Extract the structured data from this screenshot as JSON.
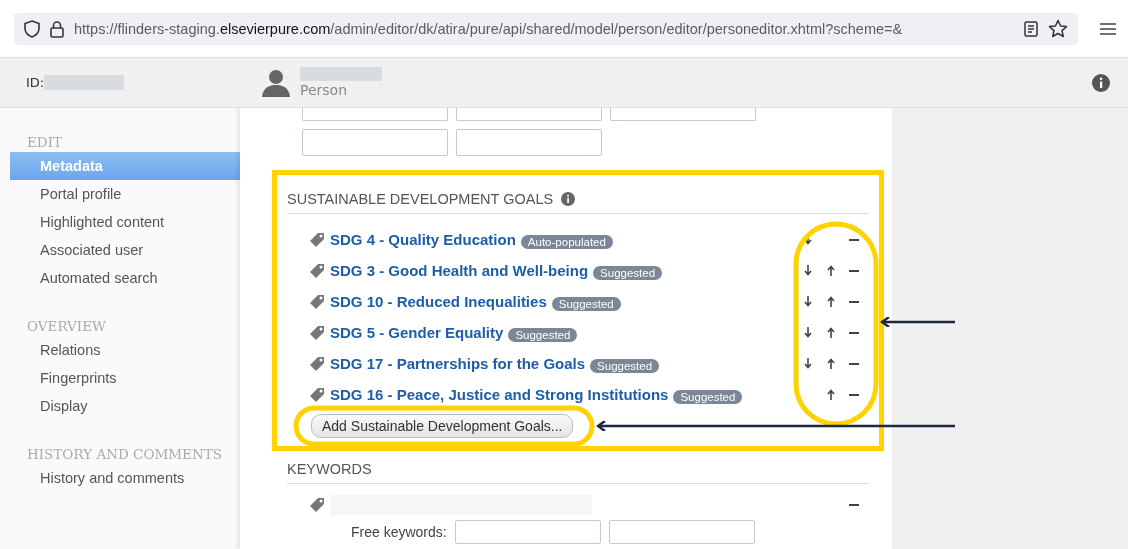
{
  "browser": {
    "url_prefix": "https://flinders-staging.",
    "url_domain": "elsevierpure.com",
    "url_path": "/admin/editor/dk/atira/pure/api/shared/model/person/editor/personeditor.xhtml?scheme=&"
  },
  "header": {
    "id_label": "ID:",
    "type_label": "Person"
  },
  "sidebar": {
    "sections": [
      {
        "title": "EDIT",
        "items": [
          {
            "label": "Metadata",
            "selected": true
          },
          {
            "label": "Portal profile",
            "selected": false
          },
          {
            "label": "Highlighted content",
            "selected": false
          },
          {
            "label": "Associated user",
            "selected": false
          },
          {
            "label": "Automated search",
            "selected": false
          }
        ]
      },
      {
        "title": "OVERVIEW",
        "items": [
          {
            "label": "Relations",
            "selected": false
          },
          {
            "label": "Fingerprints",
            "selected": false
          },
          {
            "label": "Display",
            "selected": false
          }
        ]
      },
      {
        "title": "HISTORY AND COMMENTS",
        "items": [
          {
            "label": "History and comments",
            "selected": false
          }
        ]
      }
    ]
  },
  "sdg": {
    "title": "SUSTAINABLE DEVELOPMENT GOALS",
    "goals": [
      {
        "label": "SDG 4 - Quality Education",
        "badge": "Auto-populated",
        "can_move_down": true,
        "can_move_up": false
      },
      {
        "label": "SDG 3 - Good Health and Well-being",
        "badge": "Suggested",
        "can_move_down": true,
        "can_move_up": true
      },
      {
        "label": "SDG 10 - Reduced Inequalities",
        "badge": "Suggested",
        "can_move_down": true,
        "can_move_up": true
      },
      {
        "label": "SDG 5 - Gender Equality",
        "badge": "Suggested",
        "can_move_down": true,
        "can_move_up": true
      },
      {
        "label": "SDG 17 - Partnerships for the Goals",
        "badge": "Suggested",
        "can_move_down": true,
        "can_move_up": true
      },
      {
        "label": "SDG 16 - Peace, Justice and Strong Institutions",
        "badge": "Suggested",
        "can_move_down": false,
        "can_move_up": true
      }
    ],
    "add_button": "Add Sustainable Development Goals..."
  },
  "keywords": {
    "title": "KEYWORDS",
    "free_keywords_label": "Free keywords:"
  }
}
